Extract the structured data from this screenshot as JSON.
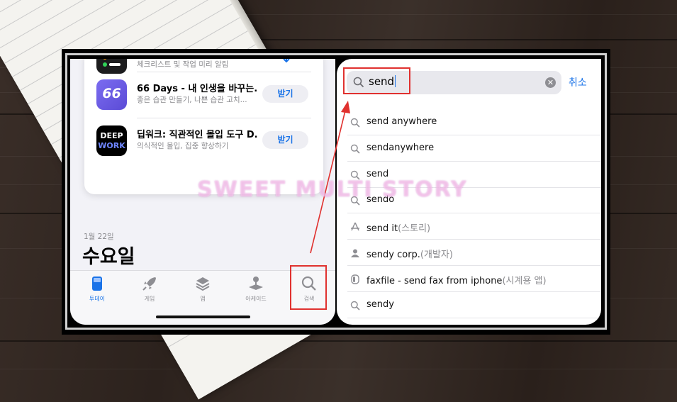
{
  "left_panel": {
    "top_row_sub": "체크리스트 및 작업 미리 알림",
    "apps": [
      {
        "title": "66 Days - 내 인생을 바꾸는...",
        "subtitle": "좋은 습관 만들기, 나쁜 습관 고치...",
        "button": "받기",
        "icon_text": "66"
      },
      {
        "title": "딥워크: 직관적인 몰입 도구 D...",
        "subtitle": "의식적인 몰입, 집중 향상하기",
        "button": "받기",
        "icon_text_1": "DEEP",
        "icon_text_2": "WORK"
      }
    ],
    "date": "1월 22일",
    "day": "수요일",
    "tabs": [
      {
        "label": "투데이",
        "icon": "today-icon"
      },
      {
        "label": "게임",
        "icon": "rocket-icon"
      },
      {
        "label": "앱",
        "icon": "layers-icon"
      },
      {
        "label": "아케이드",
        "icon": "joystick-icon"
      },
      {
        "label": "검색",
        "icon": "search-icon"
      }
    ]
  },
  "right_panel": {
    "search_query": "send",
    "cancel_label": "취소",
    "suggestions": [
      {
        "text": "send anywhere",
        "type": "",
        "icon": "search-icon"
      },
      {
        "text": "sendanywhere",
        "type": "",
        "icon": "search-icon"
      },
      {
        "text": "send",
        "type": "",
        "icon": "search-icon"
      },
      {
        "text": "sendo",
        "type": "",
        "icon": "search-icon"
      },
      {
        "text": "send it",
        "type": "(스토리)",
        "icon": "appstore-icon"
      },
      {
        "text": "sendy corp.",
        "type": "(개발자)",
        "icon": "person-icon"
      },
      {
        "text": "faxfile - send fax from iphone",
        "type": "(시계용 앱)",
        "icon": "watch-icon"
      },
      {
        "text": "sendy",
        "type": "",
        "icon": "search-icon"
      }
    ]
  },
  "watermark": "SWEET MULTI STORY",
  "colors": {
    "accent": "#1a73e8",
    "highlight": "#e0312f"
  }
}
